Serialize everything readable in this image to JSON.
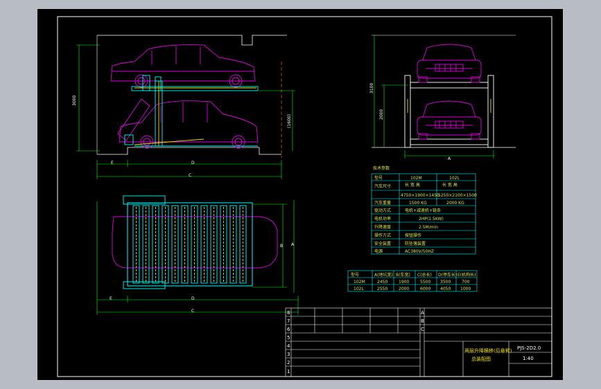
{
  "drawing": {
    "colors": {
      "background": "#000000",
      "frame": "#ffffff",
      "car": "#e000e0",
      "structure": "#00ffff",
      "dimension": "#00ff00",
      "table_line": "#00ffff",
      "centerline": "#ff0000",
      "table_text": "#e0e640"
    },
    "dims": {
      "side_height_total": "3000",
      "side_height_lower": "(1600)",
      "side_E": "E",
      "side_D": "D",
      "side_C": "C",
      "front_total": "3100",
      "front_lower": "2000",
      "front_A": "A",
      "top_B": "B",
      "top_A": "A",
      "top_E": "E",
      "top_D": "D",
      "top_C": "C"
    },
    "spec_table": {
      "title": "技术参数",
      "model_label": "型号",
      "model_col1": "102M",
      "model_col2": "102L",
      "rows": [
        {
          "label": "汽车尺寸",
          "sub1": "长  宽  高",
          "sub2": "长  宽  高",
          "v1": "4750×1900×1450",
          "v2": "5250×2100×1500"
        },
        {
          "label": "汽车重量",
          "v1": "1500 KG",
          "v2": "2000 KG"
        },
        {
          "label": "驱动方式",
          "v": "电机+减速机+链条"
        },
        {
          "label": "电机功率",
          "v": "2HP(1.5KW)"
        },
        {
          "label": "升降速度",
          "v": "2.5M/min"
        },
        {
          "label": "操作方式",
          "v": "按钮操作"
        },
        {
          "label": "安全装置",
          "v": "防坠落装置"
        },
        {
          "label": "电源",
          "v": "AC380V/50HZ"
        }
      ]
    },
    "dim_table": {
      "headers": [
        "型号",
        "A(地坑宽)",
        "B(车宽)",
        "C(总长)",
        "D(停车长)",
        "E(机构长)"
      ],
      "rows": [
        [
          "102M",
          "2450",
          "1900",
          "5500",
          "3500",
          "700"
        ],
        [
          "102L",
          "2550",
          "2000",
          "6000",
          "4050",
          "1000"
        ]
      ]
    },
    "title_block": {
      "drawing_no": "PJS-2D2.0",
      "title_line1": "两层升降横移(后悬臂)",
      "title_line2": "总装配图",
      "row_numbers": [
        "8",
        "7",
        "6",
        "5",
        "4",
        "3",
        "2",
        "1"
      ],
      "col_letters": [
        "A",
        "B",
        "C"
      ],
      "scale": "1:40"
    }
  }
}
